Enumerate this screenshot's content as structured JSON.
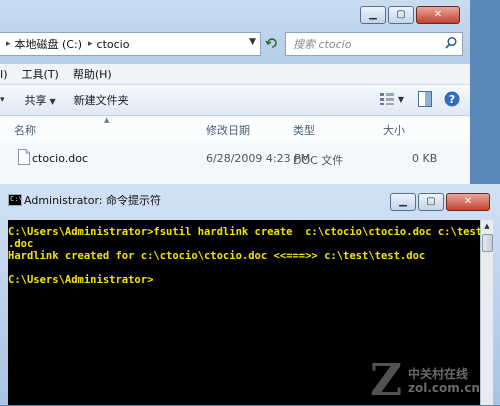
{
  "explorer": {
    "breadcrumbs": [
      "本地磁盘 (C:)",
      "ctocio"
    ],
    "search_placeholder": "搜索 ctocio",
    "menu": [
      "I)",
      "工具(T)",
      "帮助(H)"
    ],
    "commands": {
      "share": "共享",
      "new_folder": "新建文件夹"
    },
    "columns": {
      "name": "名称",
      "modified": "修改日期",
      "type": "类型",
      "size": "大小"
    },
    "files": [
      {
        "name": "ctocio.doc",
        "modified": "6/28/2009 4:23 PM",
        "type": "DOC 文件",
        "size": "0 KB"
      }
    ]
  },
  "cmd": {
    "title": "Administrator: 命令提示符",
    "lines": [
      "C:\\Users\\Administrator>fsutil hardlink create  c:\\ctocio\\ctocio.doc c:\\test\\test",
      ".doc",
      "Hardlink created for c:\\ctocio\\ctocio.doc <<===>> c:\\test\\test.doc",
      "",
      "C:\\Users\\Administrator>"
    ]
  },
  "watermark": {
    "line1": "中关村在线",
    "line2": "zol.com.cn"
  },
  "colors": {
    "console_text": "#f2e600",
    "console_bg": "#000000",
    "chrome": "#b5cde9"
  }
}
